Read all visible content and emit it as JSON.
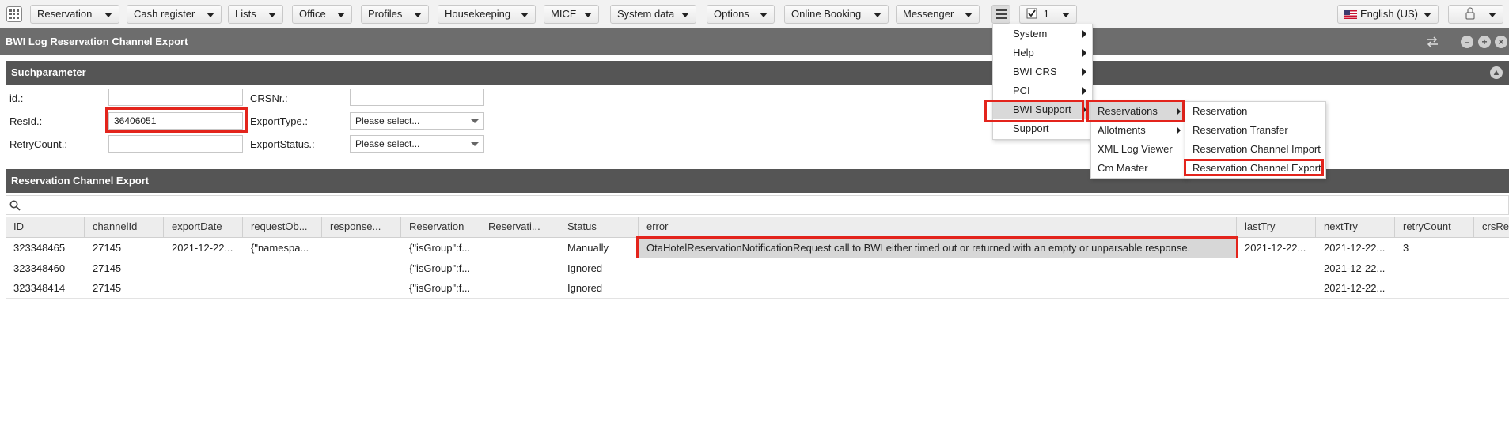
{
  "topbar": {
    "menus": [
      "Reservation",
      "Cash register",
      "Lists",
      "Office",
      "Profiles",
      "Housekeeping",
      "MICE",
      "System data",
      "Options",
      "Online Booking",
      "Messenger"
    ],
    "task_count": "1",
    "language": "English (US)"
  },
  "window": {
    "title": "BWI Log Reservation Channel Export"
  },
  "search": {
    "title": "Suchparameter",
    "labels": {
      "id": "id.:",
      "resid": "ResId.:",
      "retry": "RetryCount.:",
      "crsnr": "CRSNr.:",
      "exporttype": "ExportType.:",
      "exportstatus": "ExportStatus.:"
    },
    "values": {
      "id": "",
      "resid": "36406051",
      "retry": "",
      "crsnr": ""
    },
    "select_placeholder": "Please select..."
  },
  "grid": {
    "title": "Reservation Channel Export",
    "columns": [
      "ID",
      "channelId",
      "exportDate",
      "requestOb...",
      "response...",
      "Reservation",
      "Reservati...",
      "Status",
      "error",
      "lastTry",
      "nextTry",
      "retryCount",
      "crsRe"
    ],
    "rows": [
      [
        "323348465",
        "27145",
        "2021-12-22...",
        "{\"namespa...",
        "",
        "{\"isGroup\":f...",
        "",
        "Manually",
        "OtaHotelReservationNotificationRequest call to BWI either timed out or returned with an empty or unparsable response.",
        "2021-12-22...",
        "2021-12-22...",
        "3",
        ""
      ],
      [
        "323348460",
        "27145",
        "",
        "",
        "",
        "{\"isGroup\":f...",
        "",
        "Ignored",
        "",
        "",
        "2021-12-22...",
        "",
        ""
      ],
      [
        "323348414",
        "27145",
        "",
        "",
        "",
        "{\"isGroup\":f...",
        "",
        "Ignored",
        "",
        "",
        "2021-12-22...",
        "",
        ""
      ]
    ]
  },
  "menu_main": {
    "items": [
      "System",
      "Help",
      "BWI CRS",
      "PCI",
      "BWI Support",
      "Support"
    ],
    "selected": "BWI Support"
  },
  "menu_bwi": {
    "items": [
      "Reservations",
      "Allotments",
      "XML Log Viewer",
      "Cm Master"
    ],
    "selected": "Reservations"
  },
  "menu_res": {
    "items": [
      "Reservation",
      "Reservation Transfer",
      "Reservation Channel Import",
      "Reservation Channel Export"
    ],
    "selected": "Reservation Channel Export"
  },
  "colors": {
    "highlight": "#e3241c",
    "header": "#555555",
    "title": "#6d6d6d"
  }
}
